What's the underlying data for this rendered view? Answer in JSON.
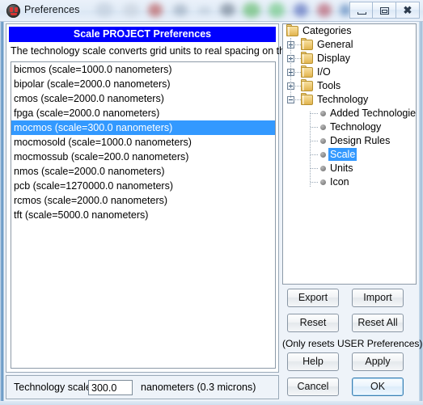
{
  "window": {
    "title": "Preferences",
    "icon": "app-bug-icon",
    "controls": {
      "minimize": "minimize-icon",
      "maximize": "maximize-icon",
      "close": "close-icon"
    }
  },
  "colors": {
    "header_blue": "#0000ff",
    "selection_blue": "#3399ff",
    "selection_text": "#ffffff",
    "default_button_border": "#3c7fb1",
    "folder_yellow": "#edc973"
  },
  "main_panel": {
    "header_title": "Scale PROJECT Preferences",
    "description": "The technology scale converts grid units to real spacing on the chip:",
    "technologies": [
      {
        "label": "bicmos (scale=1000.0 nanometers)",
        "selected": false
      },
      {
        "label": "bipolar (scale=2000.0 nanometers)",
        "selected": false
      },
      {
        "label": "cmos (scale=2000.0 nanometers)",
        "selected": false
      },
      {
        "label": "fpga (scale=2000.0 nanometers)",
        "selected": false
      },
      {
        "label": "mocmos (scale=300.0 nanometers)",
        "selected": true
      },
      {
        "label": "mocmosold (scale=1000.0 nanometers)",
        "selected": false
      },
      {
        "label": "mocmossub (scale=200.0 nanometers)",
        "selected": false
      },
      {
        "label": "nmos (scale=2000.0 nanometers)",
        "selected": false
      },
      {
        "label": "pcb (scale=1270000.0 nanometers)",
        "selected": false
      },
      {
        "label": "rcmos (scale=2000.0 nanometers)",
        "selected": false
      },
      {
        "label": "tft (scale=5000.0 nanometers)",
        "selected": false
      }
    ]
  },
  "scale_row": {
    "label": "Technology scale:",
    "value": "300.0",
    "units": "nanometers (0.3 microns)"
  },
  "tree": {
    "root": "Categories",
    "nodes": [
      {
        "label": "General",
        "type": "folder",
        "expander": "plus"
      },
      {
        "label": "Display",
        "type": "folder",
        "expander": "plus"
      },
      {
        "label": "I/O",
        "type": "folder",
        "expander": "plus"
      },
      {
        "label": "Tools",
        "type": "folder",
        "expander": "plus"
      },
      {
        "label": "Technology",
        "type": "folder",
        "expander": "minus"
      },
      {
        "label": "Added Technologies",
        "type": "leaf",
        "selected": false
      },
      {
        "label": "Technology",
        "type": "leaf",
        "selected": false
      },
      {
        "label": "Design Rules",
        "type": "leaf",
        "selected": false
      },
      {
        "label": "Scale",
        "type": "leaf",
        "selected": true
      },
      {
        "label": "Units",
        "type": "leaf",
        "selected": false
      },
      {
        "label": "Icon",
        "type": "leaf",
        "selected": false
      }
    ]
  },
  "buttons": {
    "export": "Export",
    "import": "Import",
    "reset": "Reset",
    "reset_all": "Reset All",
    "reset_note": "(Only resets USER Preferences)",
    "help": "Help",
    "apply": "Apply",
    "cancel": "Cancel",
    "ok": "OK"
  }
}
